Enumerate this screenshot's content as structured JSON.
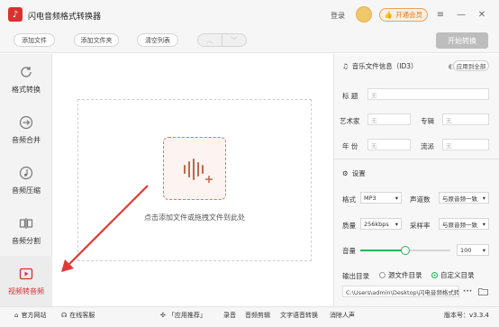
{
  "app": {
    "title": "闪电音频格式转换器",
    "login": "登录",
    "vip": "开通会员"
  },
  "toolbar": {
    "add_file": "添加文件",
    "add_folder": "添加文件夹",
    "clear_list": "清空列表",
    "start": "开始转换"
  },
  "sidebar": {
    "items": [
      {
        "label": "格式转换",
        "icon": "refresh-icon"
      },
      {
        "label": "音频合并",
        "icon": "merge-icon"
      },
      {
        "label": "音频压缩",
        "icon": "music-note-icon"
      },
      {
        "label": "音频分割",
        "icon": "split-icon"
      },
      {
        "label": "视频转音频",
        "icon": "play-icon",
        "active": true
      }
    ]
  },
  "main": {
    "drop_text": "点击添加文件或拖拽文件到此处"
  },
  "panel": {
    "id3_title": "音乐文件信息（ID3）",
    "apply_all": "应用到全部",
    "fields": {
      "title_label": "标 题",
      "artist_label": "艺术家",
      "album_label": "专辑",
      "year_label": "年 份",
      "genre_label": "流派",
      "empty": "无"
    },
    "settings_title": "设置",
    "format_label": "格式",
    "format_value": "MP3",
    "channels_label": "声道数",
    "channels_value": "与原音频一致",
    "quality_label": "质量",
    "quality_value": "256kbps",
    "samplerate_label": "采样率",
    "samplerate_value": "与原音频一致",
    "volume_label": "音量",
    "volume_value": "100",
    "volume_fraction": 0.5,
    "output_label": "输出目录",
    "source_dir": "源文件目录",
    "custom_dir": "自定义目录",
    "output_path": "C:\\Users\\admin\\Desktop\\闪电音频格式转",
    "more": "•••"
  },
  "footer": {
    "website": "官方网站",
    "service": "在线客服",
    "recommend": "「应用推荐」",
    "apps": [
      "录音",
      "音频剪辑",
      "文字语音转换",
      "消除人声"
    ],
    "version": "版本号：v3.3.4"
  },
  "colors": {
    "brand": "#d8312e",
    "accent_green": "#27b35a",
    "vip_orange": "#d97a29"
  }
}
